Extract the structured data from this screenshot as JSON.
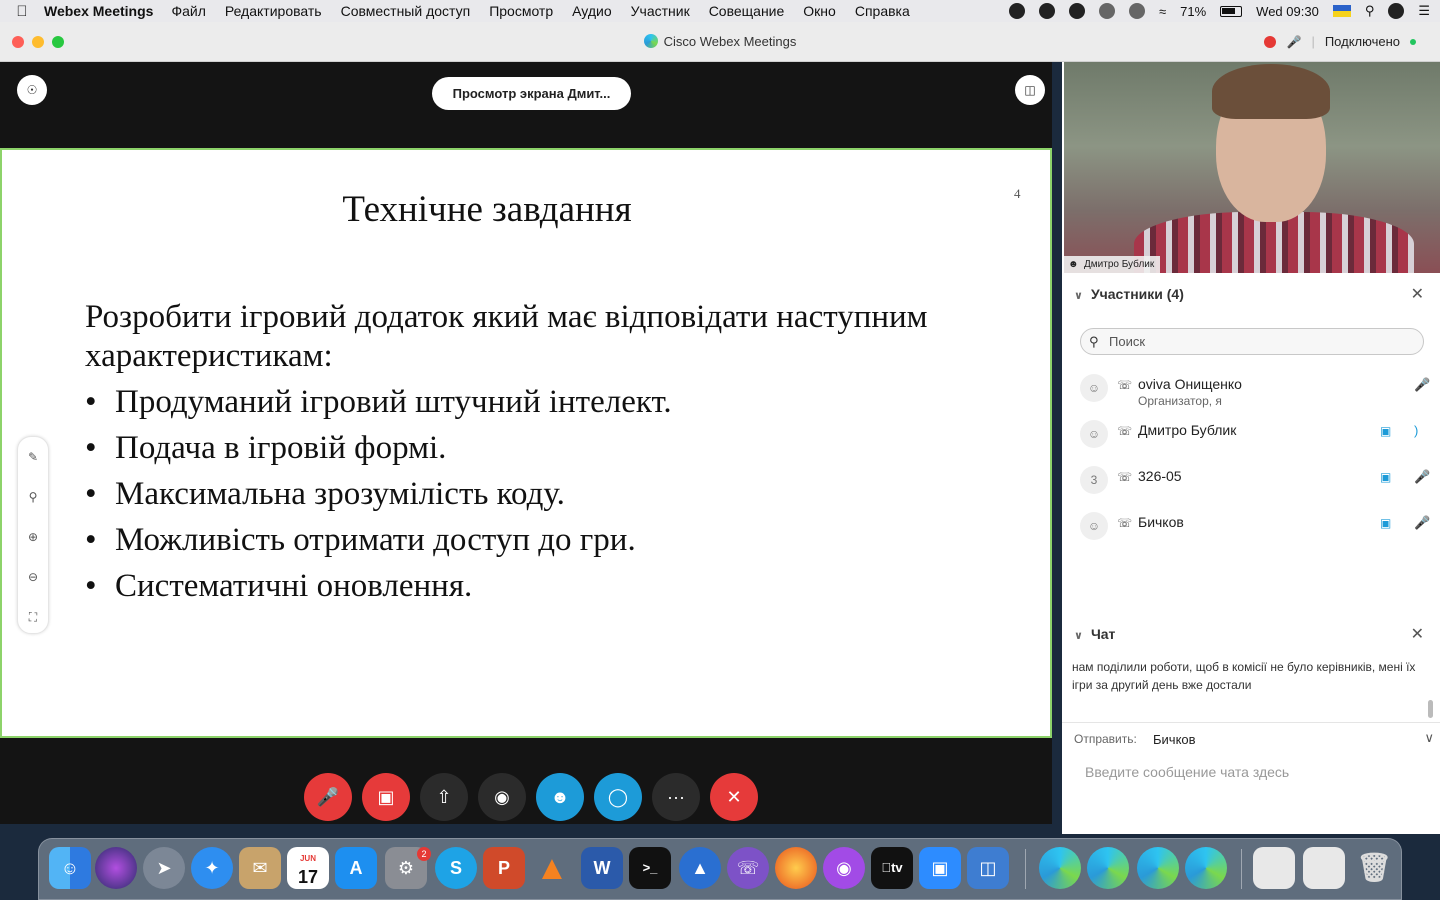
{
  "menubar": {
    "app_name": "Webex Meetings",
    "items": [
      "Файл",
      "Редактировать",
      "Совместный доступ",
      "Просмотр",
      "Аудио",
      "Участник",
      "Совещание",
      "Окно",
      "Справка"
    ],
    "battery": "71%",
    "clock": "Wed 09:30"
  },
  "window": {
    "title": "Cisco Webex Meetings",
    "status": "Подключено"
  },
  "share": {
    "view_label": "Просмотр экрана Дмит...",
    "slide": {
      "number": "4",
      "title": "Технічне завдання",
      "intro": "Розробити ігровий додаток який має відповідати наступним характеристикам:",
      "bullets": [
        "Продуманий ігровий штучний інтелект.",
        "Подача в ігровій формі.",
        "Максимальна зрозумілість коду.",
        "Можливість отримати доступ до гри.",
        "Систематичні оновлення."
      ]
    }
  },
  "video": {
    "name": "Дмитро Бублик"
  },
  "participants": {
    "header": "Участники (4)",
    "search_placeholder": "Поиск",
    "list": [
      {
        "name": "oviva Онищенко",
        "role": "Организатор, я",
        "avatar": "",
        "muted": true,
        "video": false
      },
      {
        "name": "Дмитро Бублик",
        "role": "",
        "avatar": "",
        "muted": false,
        "video": true
      },
      {
        "name": "326-05",
        "role": "",
        "avatar": "3",
        "muted": true,
        "video": true
      },
      {
        "name": "Бичков",
        "role": "",
        "avatar": "",
        "muted": true,
        "video": true
      }
    ]
  },
  "chat": {
    "header": "Чат",
    "message": "нам поділили роботи, щоб в комісії не було керівників, мені їх ігри за другий день вже достали",
    "send_label": "Отправить:",
    "send_to": "Бичков",
    "input_placeholder": "Введите сообщение чата здесь"
  },
  "dock": {
    "calendar_month": "JUN",
    "calendar_day": "17",
    "settings_badge": "2",
    "tv_label": "tv"
  },
  "colors": {
    "accent_blue": "#1d9bd8",
    "end_red": "#e63a3a",
    "slide_border": "#8dd36a"
  }
}
